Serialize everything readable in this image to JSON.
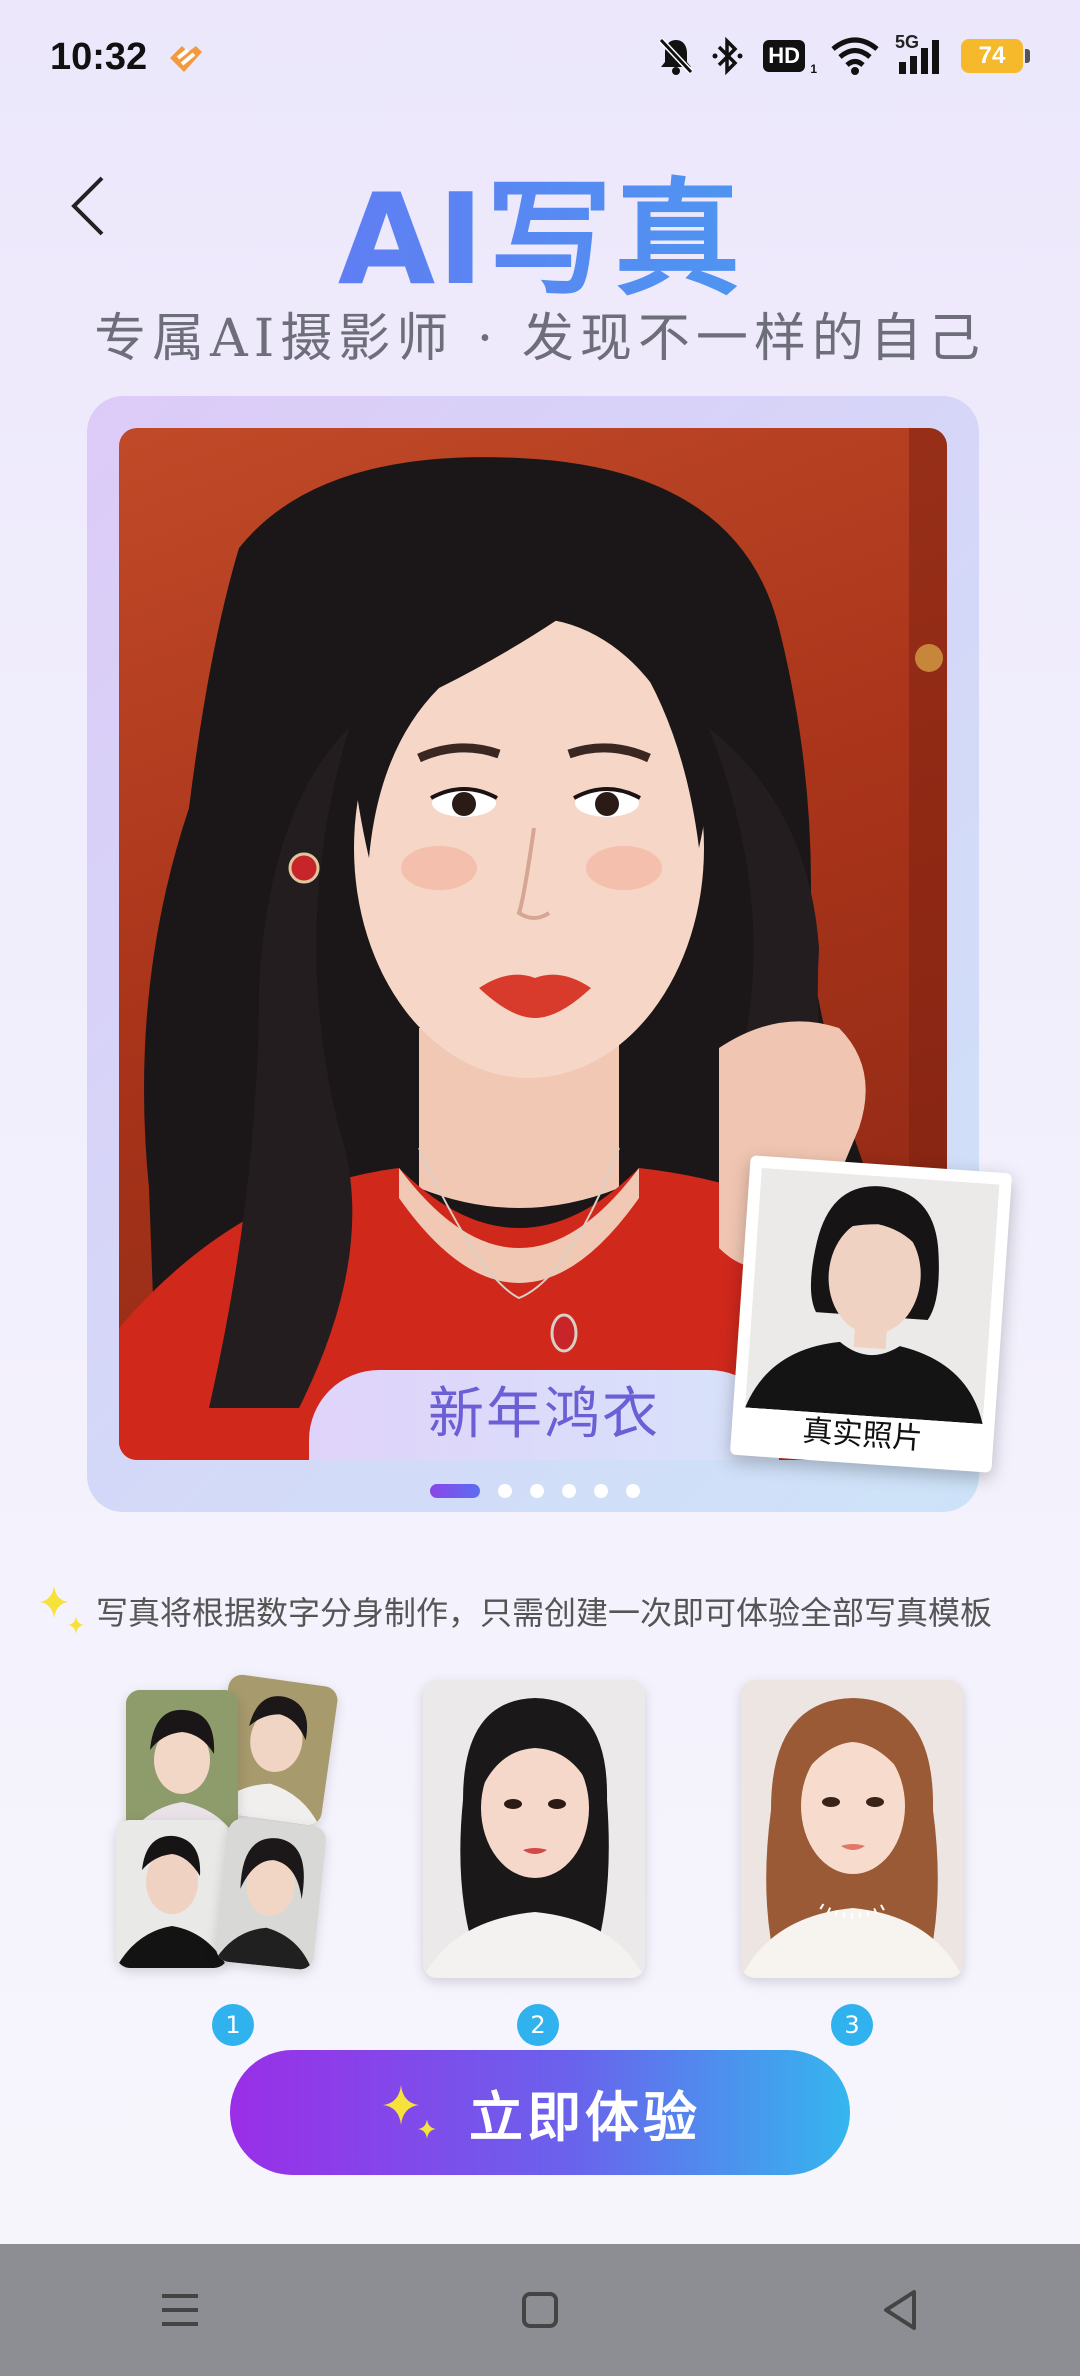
{
  "status_bar": {
    "time": "10:32",
    "hd_label": "HD",
    "hd_sub": "1",
    "network_label": "5G",
    "battery": "74",
    "icons": [
      "app-heart-icon",
      "mute-bell-icon",
      "bluetooth-icon",
      "hd-icon",
      "wifi-icon",
      "signal-icon",
      "battery-icon"
    ]
  },
  "header": {
    "back_icon": "chevron-left-icon",
    "title": "AI写真",
    "subtitle": "专属AI摄影师 · 发现不一样的自己"
  },
  "showcase": {
    "style_name": "新年鸿衣",
    "real_photo_caption": "真实照片",
    "carousel": {
      "count": 6,
      "active_index": 0
    }
  },
  "info": {
    "text": "写真将根据数字分身制作，只需创建一次即可体验全部写真模板",
    "icon": "sparkle-icon"
  },
  "steps": [
    {
      "number": "1"
    },
    {
      "number": "2"
    },
    {
      "number": "3"
    }
  ],
  "cta": {
    "label": "立即体验",
    "icon": "sparkle-icon"
  },
  "nav": {
    "icons": [
      "menu-icon",
      "home-square-icon",
      "back-triangle-icon"
    ]
  },
  "colors": {
    "title_gradient_start": "#6b6cf5",
    "title_gradient_end": "#3fa7ee",
    "cta_gradient_start": "#9a2ee8",
    "cta_gradient_end": "#35b6ee",
    "step_badge": "#2fb2ee",
    "battery": "#f6b92b"
  }
}
